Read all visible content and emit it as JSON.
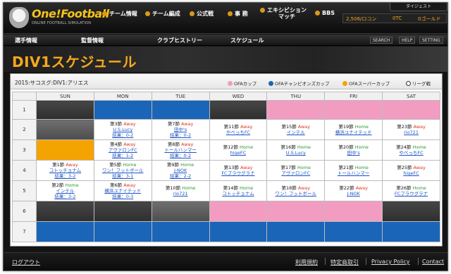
{
  "header": {
    "brand": "One!Football",
    "tagline": "ONLINE FOOTBALL SIMULATION",
    "nav": [
      "チーム情報",
      "チーム編成",
      "公式戦",
      "事 務",
      "エキシビション\nマッチ",
      "BBS"
    ],
    "currency": {
      "gold_ro": "2,506/ロコン",
      "ptc": "0TC",
      "gold": "0ゴールド"
    },
    "top_right": "ダイジェスト"
  },
  "subnav": {
    "items": [
      "選手情報",
      "監督情報",
      "クラブヒストリー",
      "スケジュール"
    ],
    "utils": [
      "SEARCH",
      "HELP",
      "SETTING"
    ]
  },
  "page": {
    "title": "DIV1スケジュール"
  },
  "schedule": {
    "season_label": "2015:サコスグ:DIV1:アリエス",
    "legend": [
      {
        "label": "OFAカップ",
        "color": "#f39cc2"
      },
      {
        "label": "OFAチャンピオンズカップ",
        "color": "#1a65b7"
      },
      {
        "label": "OFAスーパーカップ",
        "color": "#f5a300"
      },
      {
        "label": "リーグ戦",
        "color": "#ffffff"
      }
    ],
    "days": [
      "SUN",
      "MON",
      "TUE",
      "WED",
      "THU",
      "FRI",
      "SAT"
    ],
    "weeks": [
      "1",
      "2",
      "3",
      "4",
      "5",
      "6",
      "7"
    ],
    "matches": {
      "w2_mon": {
        "round": "第3節",
        "ha": "Away",
        "opp": "U.S.Lucy",
        "res": "結果：0-2"
      },
      "w2_tue": {
        "round": "第7節",
        "ha": "Away",
        "opp": "田中's",
        "res": "結果：0-2"
      },
      "w2_wed": {
        "round": "第11節",
        "ha": "Away",
        "opp": "やべっちFC",
        "res": ""
      },
      "w2_thu": {
        "round": "第15節",
        "ha": "Away",
        "opp": "インテル",
        "res": ""
      },
      "w2_fri": {
        "round": "第19節",
        "ha": "Home",
        "opp": "横浜ユナイテッド",
        "res": ""
      },
      "w2_sat": {
        "round": "第23節",
        "ha": "Away",
        "opp": "rio721",
        "res": ""
      },
      "w3_mon": {
        "round": "第4節",
        "ha": "Away",
        "opp": "アヴァロンFC",
        "res": "結果：1-2"
      },
      "w3_tue": {
        "round": "第8節",
        "ha": "Away",
        "opp": "トールハンマー",
        "res": "結果：0-2"
      },
      "w3_wed": {
        "round": "第12節",
        "ha": "Home",
        "opp": "higeFC",
        "res": ""
      },
      "w3_thu": {
        "round": "第16節",
        "ha": "Home",
        "opp": "U.S.Lucy",
        "res": ""
      },
      "w3_fri": {
        "round": "第20節",
        "ha": "Home",
        "opp": "田中's",
        "res": ""
      },
      "w3_sat": {
        "round": "第24節",
        "ha": "Home",
        "opp": "やべっちFC",
        "res": ""
      },
      "w4_sun": {
        "round": "第1節",
        "ha": "Away",
        "opp": "コトッチョナム",
        "res": "結果：3-2"
      },
      "w4_mon": {
        "round": "第5節",
        "ha": "Home",
        "opp": "ワン！フットボール",
        "res": "結果：3-1"
      },
      "w4_tue": {
        "round": "第9節",
        "ha": "Home",
        "opp": "J-NOK",
        "res": "結果：2-2"
      },
      "w4_wed": {
        "round": "第13節",
        "ha": "Away",
        "opp": "FCプラウグラナ",
        "res": ""
      },
      "w4_thu": {
        "round": "第17節",
        "ha": "Home",
        "opp": "アヴァロンFC",
        "res": ""
      },
      "w4_fri": {
        "round": "第21節",
        "ha": "Home",
        "opp": "トールハンマー",
        "res": ""
      },
      "w4_sat": {
        "round": "第25節",
        "ha": "Away",
        "opp": "higeFC",
        "res": ""
      },
      "w5_sun": {
        "round": "第2節",
        "ha": "Home",
        "opp": "インテル",
        "res": "結果：3-2"
      },
      "w5_mon": {
        "round": "第6節",
        "ha": "Away",
        "opp": "横浜ユナイテッド",
        "res": "結果：0-3"
      },
      "w5_tue": {
        "round": "第10節",
        "ha": "Home",
        "opp": "rio721",
        "res": ""
      },
      "w5_wed": {
        "round": "第14節",
        "ha": "Home",
        "opp": "コトッチョナム",
        "res": ""
      },
      "w5_thu": {
        "round": "第18節",
        "ha": "Away",
        "opp": "ワン！フットボール",
        "res": ""
      },
      "w5_fri": {
        "round": "第22節",
        "ha": "Away",
        "opp": "J-NOK",
        "res": ""
      },
      "w5_sat": {
        "round": "第26節",
        "ha": "Home",
        "opp": "FCプラウグラナ",
        "res": ""
      }
    }
  },
  "footer": {
    "logout": "ログアウト",
    "links": [
      "利用規約",
      "特定商取引",
      "Privacy Policy",
      "Contact"
    ]
  }
}
